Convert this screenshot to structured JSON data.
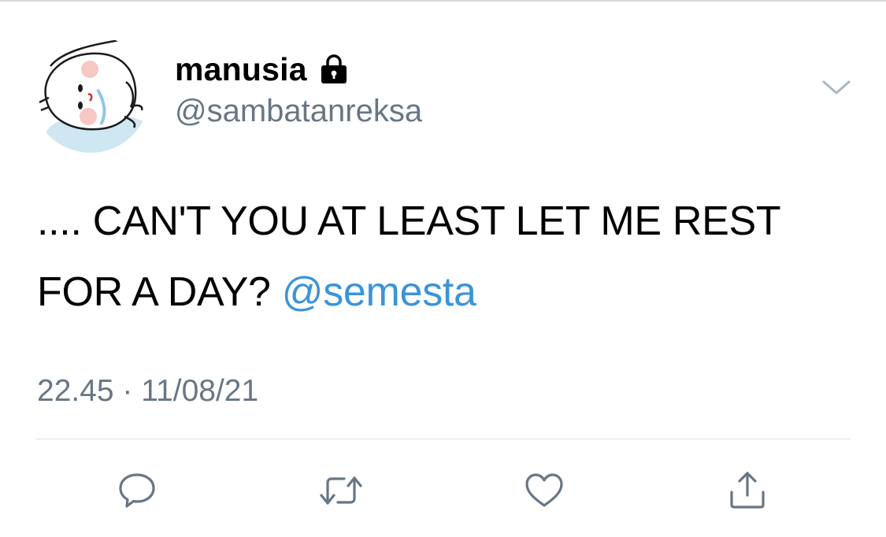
{
  "tweet": {
    "author": {
      "display_name": "manusia",
      "handle": "@sambatanreksa",
      "protected_icon": "lock-icon",
      "avatar": "avatar-illustration"
    },
    "text_main": ".... CAN'T YOU AT LEAST LET ME REST FOR A DAY?",
    "mention": "@semesta",
    "timestamp": "22.45 · 11/08/21",
    "menu_icon": "chevron-down-icon",
    "actions": [
      {
        "name": "reply",
        "icon": "speech-bubble-icon"
      },
      {
        "name": "retweet",
        "icon": "retweet-icon"
      },
      {
        "name": "like",
        "icon": "heart-icon"
      },
      {
        "name": "share",
        "icon": "share-icon"
      }
    ]
  },
  "colors": {
    "text_primary": "#000000",
    "text_secondary": "#687684",
    "link": "#3b94d9",
    "action_icon": "#687684",
    "divider": "#dadde1"
  }
}
